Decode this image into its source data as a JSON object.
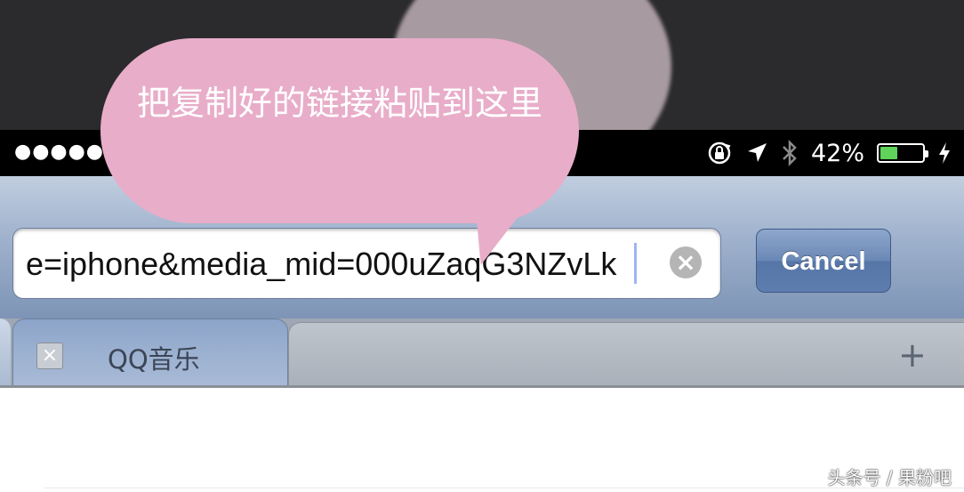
{
  "status_bar": {
    "signal": "●●●●●",
    "battery_percent_text": "42%",
    "battery_level": 0.42,
    "icons": [
      "rotation-lock-icon",
      "location-arrow-icon",
      "bluetooth-icon",
      "battery-icon",
      "charging-bolt-icon"
    ]
  },
  "callout": {
    "text": "把复制好的链接粘贴到这里"
  },
  "address_bar": {
    "url_value": "e=iphone&media_mid=000uZaqG3NZvLk",
    "clear_icon": "clear-x-icon",
    "cancel_label": "Cancel"
  },
  "tabs": {
    "active_label": "QQ音乐",
    "add_icon": "plus-icon",
    "close_icon": "close-x-icon"
  },
  "watermark": "头条号 / 果粉吧",
  "colors": {
    "callout_bg": "#e8adc9",
    "nav_gradient_top": "#c1cee0",
    "nav_gradient_bottom": "#7d94b6",
    "battery_fill": "#5fd35a"
  }
}
